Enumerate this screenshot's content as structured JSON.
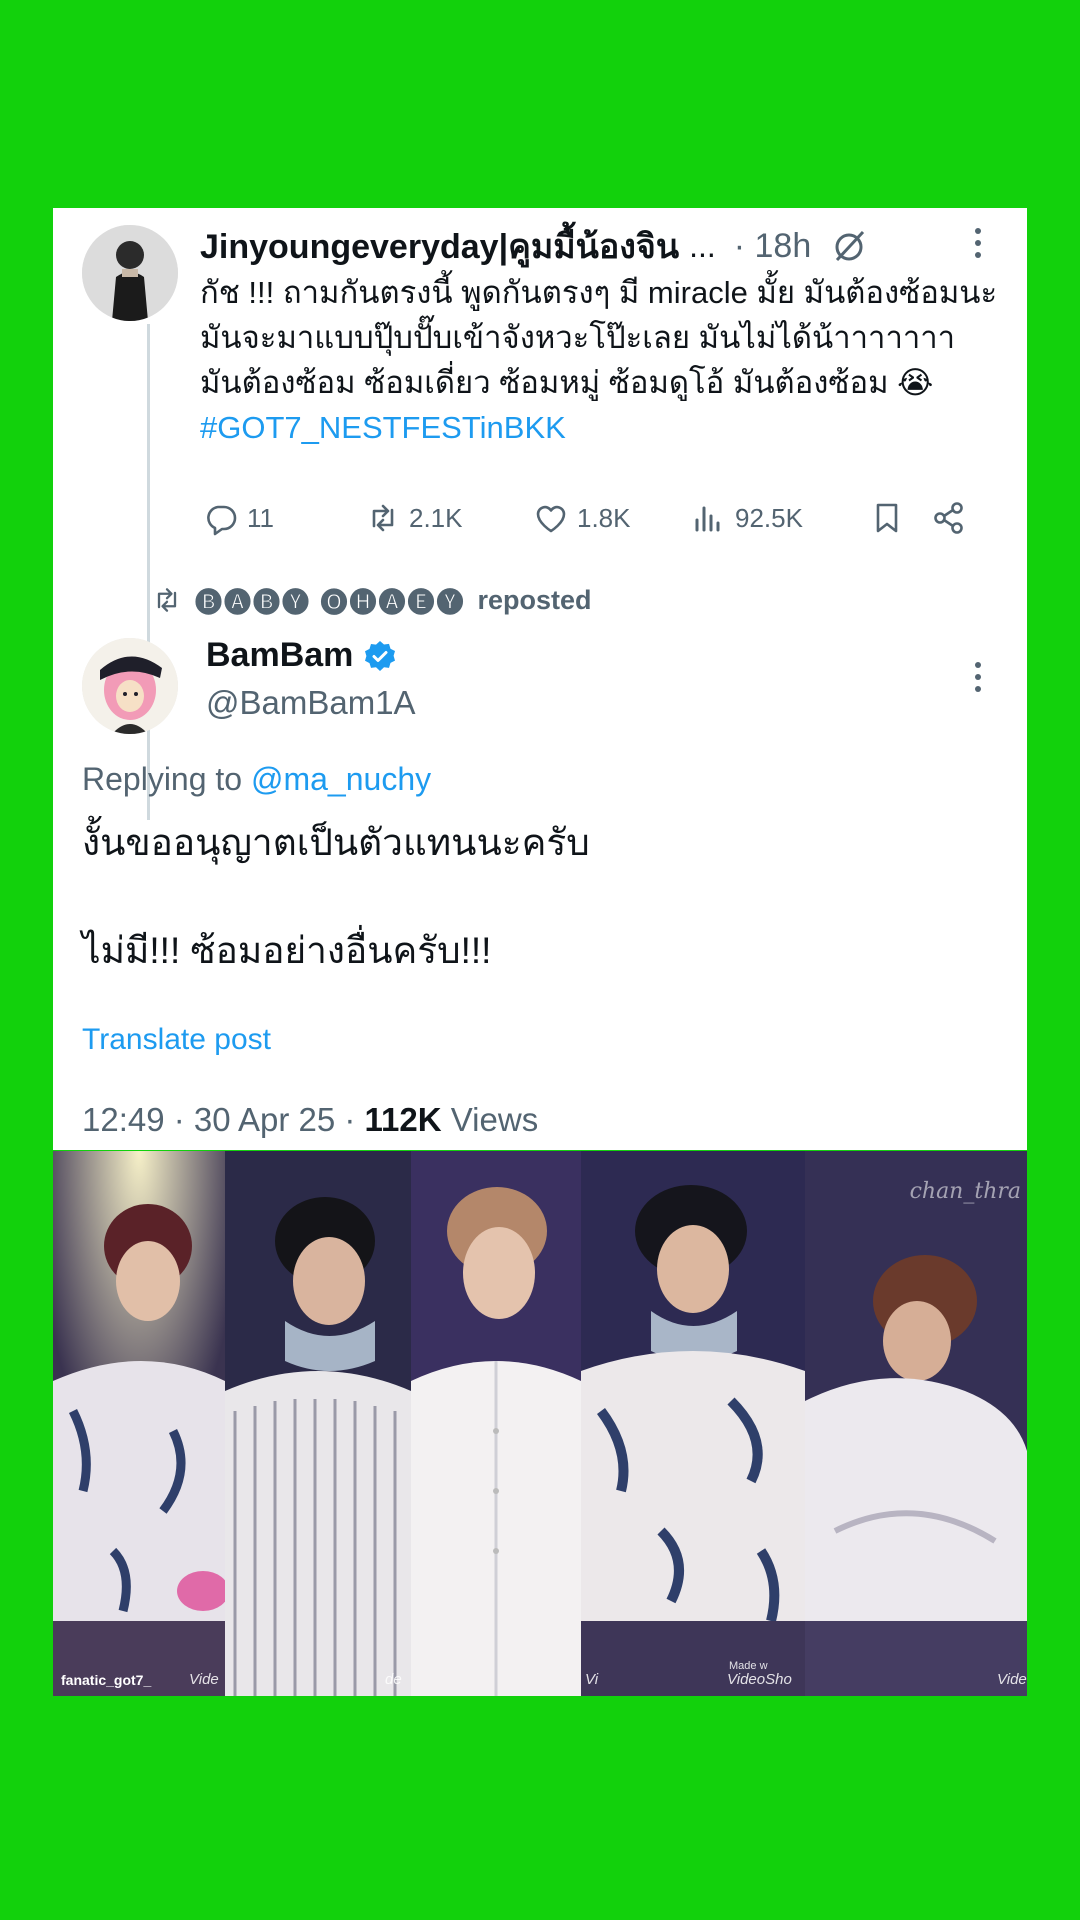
{
  "parent_tweet": {
    "display_name": "Jinyoungeveryday|คูมมื้น้องจิน",
    "ellipsis": "...",
    "time": "· 18h",
    "text": "กัช !!! ถามกันตรงนี้ พูดกันตรงๆ มี miracle มั้ย มันต้องซ้อมนะ มันจะมาแบบปุ๊บปั๊บเข้าจังหวะโป๊ะเลย มันไม่ได้น้าาาาาาา มันต้องซ้อม ซ้อมเดี่ยว ซ้อมหมู่ ซ้อมดูโอ้ มันต้องซ้อม 😭 ",
    "hashtag": "#GOT7_NESTFESTinBKK",
    "replies": "11",
    "reposts": "2.1K",
    "likes": "1.8K",
    "views": "92.5K"
  },
  "repost_banner": {
    "names": "🅑🅐🅑🅨  🅞🅗🅐🅔🅨",
    "label": "reposted"
  },
  "main_tweet": {
    "display_name": "BamBam",
    "handle": "@BamBam1A",
    "replying_prefix": "Replying to ",
    "replying_to": "@ma_nuchy",
    "text": "งั้นขออนุญาตเป็นตัวแทนนะครับ\n\nไม่มี!!! ซ้อมอย่างอื่นครับ!!!",
    "translate_label": "Translate post",
    "timestamp": "12:49 · 30 Apr 25 · ",
    "views_count": "112K",
    "views_label": " Views"
  },
  "video_watermarks": {
    "fanatic": "fanatic_got7_",
    "videoshow": "Vide",
    "videoshow_2": "de",
    "videoshow_3": "Vi",
    "made_with": "Made w",
    "videoshow_full": "VideoSho",
    "chan": "chan_thra"
  },
  "colors": {
    "background": "#12d10c",
    "link": "#1d9bf0",
    "secondary_text": "#536471",
    "verified": "#1d9bf0"
  },
  "icons": [
    "grok-icon",
    "more-icon",
    "reply-icon",
    "repost-icon",
    "like-icon",
    "views-icon",
    "bookmark-icon",
    "share-icon",
    "verified-icon"
  ]
}
